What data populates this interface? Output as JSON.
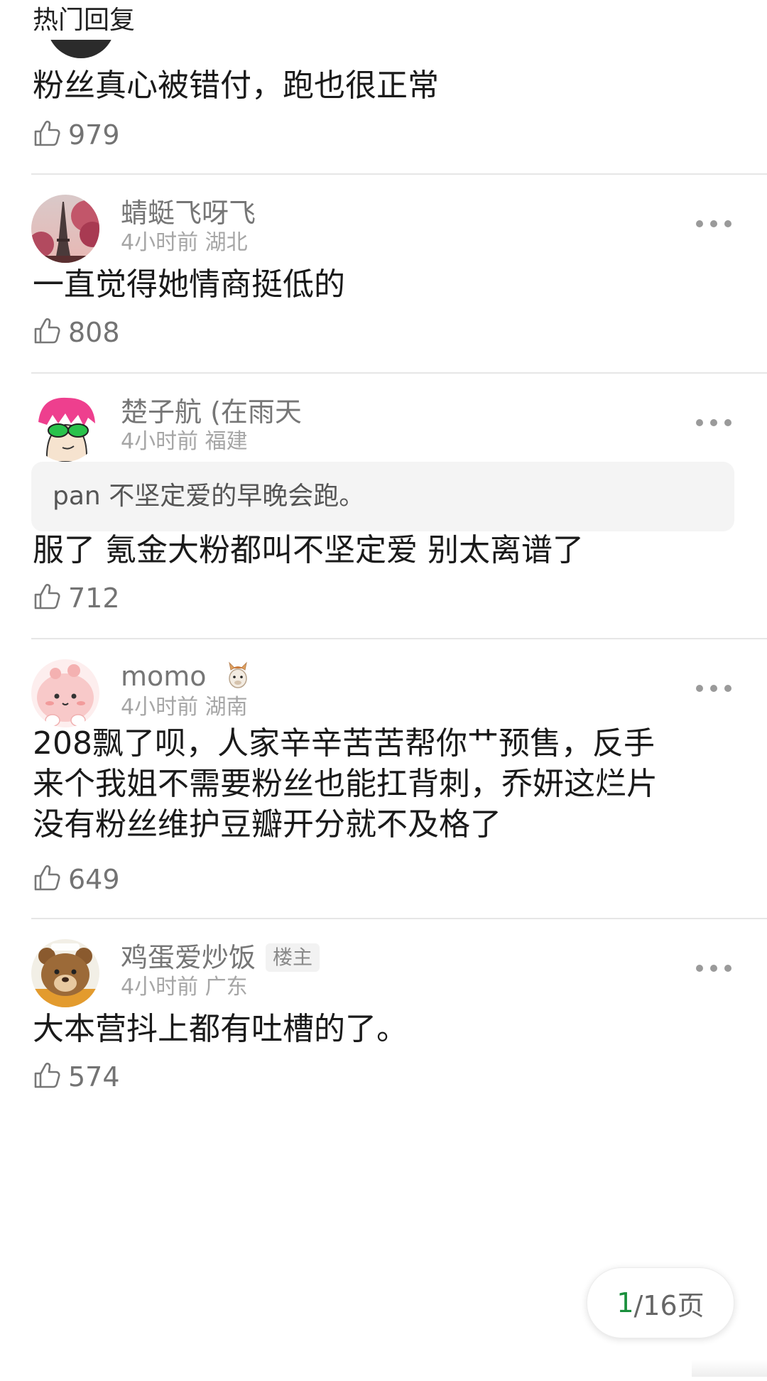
{
  "section_title": "热门回复",
  "partial_comment": {
    "text": "粉丝真心被错付，跑也很正常",
    "likes": "979"
  },
  "comments": [
    {
      "name": "蜻蜓飞呀飞",
      "time": "4小时前",
      "location": "湖北",
      "text": "一直觉得她情商挺低的",
      "likes": "808",
      "avatar_icon": "eiffel-tower-avatar"
    },
    {
      "name": "楚子航 (在雨天",
      "time": "4小时前",
      "location": "福建",
      "quote_user": "pan",
      "quote_text": "不坚定爱的早晚会跑。",
      "text": "服了 氪金大粉都叫不坚定爱 别太离谱了",
      "likes": "712",
      "avatar_icon": "cartoon-pink-hair-avatar"
    },
    {
      "name": "momo",
      "time": "4小时前",
      "location": "湖南",
      "text_lines": [
        "208飘了呗，人家辛辛苦苦帮你艹预售，反手",
        "来个我姐不需要粉丝也能扛背刺，乔妍这烂片",
        "没有粉丝维护豆瓣开分就不及格了"
      ],
      "likes": "649",
      "avatar_icon": "pink-blob-avatar",
      "name_badge_icon": "alpaca-emoji-icon"
    },
    {
      "name": "鸡蛋爱炒饭",
      "badge": "楼主",
      "time": "4小时前",
      "location": "广东",
      "text": "大本营抖上都有吐槽的了。",
      "likes": "574",
      "avatar_icon": "bear-avatar"
    }
  ],
  "pager": {
    "current": "1",
    "total": "/16页"
  },
  "colors": {
    "accent_green": "#1a8f3c",
    "divider": "#e6e6e6",
    "quote_bg": "#f4f4f4"
  }
}
